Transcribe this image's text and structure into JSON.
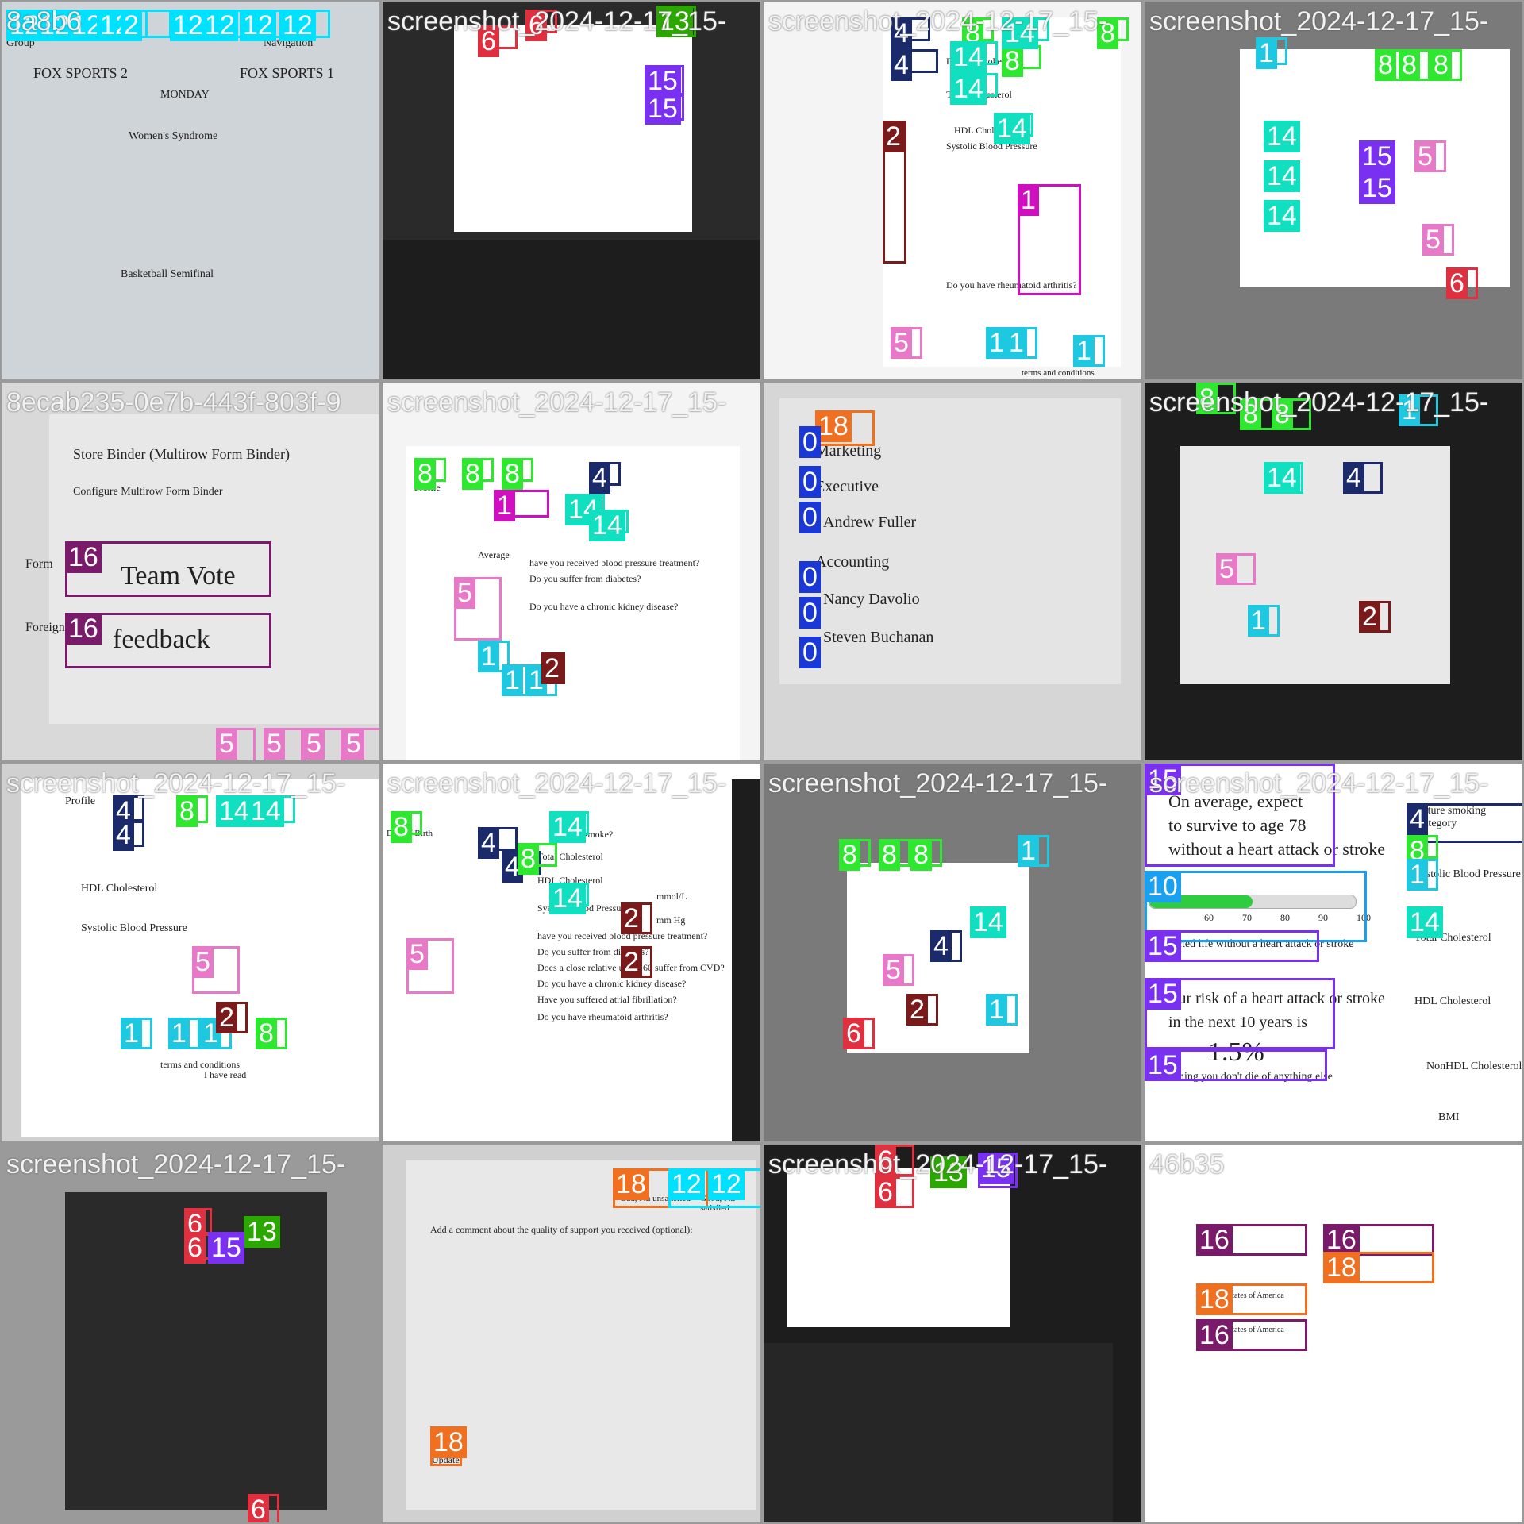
{
  "mosaic": {
    "grid": {
      "rows": 4,
      "cols": 4
    },
    "colors": {
      "c0": "#1a38d8",
      "c1": "#1ec8e0",
      "c2": "#7a1a1a",
      "c4": "#1a2a6a",
      "c5": "#e878c8",
      "c6": "#e03040",
      "c8": "#2ee830",
      "c10": "#1aa0f0",
      "c11": "#d010c0",
      "c12": "#00e0ff",
      "c13": "#2aa800",
      "c14": "#10e0c0",
      "c15": "#7a30f0",
      "c16": "#7a1a6a",
      "c18": "#f07020"
    },
    "tiles": [
      {
        "title": "8a8b6",
        "bg": "#cfd4d8",
        "boxes": [
          {
            "label": "12",
            "color": "c12"
          },
          {
            "label": "12",
            "color": "c12"
          },
          {
            "label": "12",
            "color": "c12"
          },
          {
            "label": "12",
            "color": "c12"
          },
          {
            "label": "2",
            "color": "c12"
          },
          {
            "label": "12",
            "color": "c12"
          },
          {
            "label": "12",
            "color": "c12"
          },
          {
            "label": "12",
            "color": "c12"
          },
          {
            "label": "12",
            "color": "c12"
          }
        ],
        "texts": [
          "FOX SPORTS 2",
          "FOX SPORTS 1",
          "MONDAY",
          "Women's Syndrome",
          "Basketball Semifinal",
          "Navigation",
          "Group"
        ]
      },
      {
        "title": "screenshot_2024-12-17_15-",
        "bg": "#2a2a2a",
        "boxes": [
          {
            "label": "6",
            "color": "c6"
          },
          {
            "label": "6",
            "color": "c6"
          },
          {
            "label": "13",
            "color": "c13"
          },
          {
            "label": "15",
            "color": "c15"
          },
          {
            "label": "15",
            "color": "c15"
          }
        ],
        "texts": []
      },
      {
        "title": "screenshot_2024-12-17_15-",
        "bg": "#f4f4f4",
        "boxes": [
          {
            "label": "4",
            "color": "c4"
          },
          {
            "label": "8",
            "color": "c8"
          },
          {
            "label": "14",
            "color": "c14"
          },
          {
            "label": "4",
            "color": "c4"
          },
          {
            "label": "14",
            "color": "c14"
          },
          {
            "label": "8",
            "color": "c8"
          },
          {
            "label": "14",
            "color": "c14"
          },
          {
            "label": "1",
            "color": "c11"
          },
          {
            "label": "5",
            "color": "c5"
          },
          {
            "label": "1",
            "color": "c1"
          },
          {
            "label": "1",
            "color": "c1"
          },
          {
            "label": "1",
            "color": "c1"
          },
          {
            "label": "8",
            "color": "c8"
          },
          {
            "label": "2",
            "color": "c2"
          },
          {
            "label": "14",
            "color": "c14"
          }
        ],
        "texts": [
          "Do you smoke?",
          "Total Cholesterol",
          "HDL Cholesterol",
          "Systolic Blood Pressure",
          "Do you have rheumatoid arthritis?",
          "terms and conditions"
        ]
      },
      {
        "title": "screenshot_2024-12-17_15-",
        "bg": "#7a7a7a",
        "boxes": [
          {
            "label": "1",
            "color": "c1"
          },
          {
            "label": "8",
            "color": "c8"
          },
          {
            "label": "8",
            "color": "c8"
          },
          {
            "label": "8",
            "color": "c8"
          },
          {
            "label": "5",
            "color": "c5"
          },
          {
            "label": "14",
            "color": "c14"
          },
          {
            "label": "14",
            "color": "c14"
          },
          {
            "label": "14",
            "color": "c14"
          },
          {
            "label": "15",
            "color": "c15"
          },
          {
            "label": "15",
            "color": "c15"
          },
          {
            "label": "5",
            "color": "c5"
          },
          {
            "label": "6",
            "color": "c6"
          }
        ],
        "texts": []
      },
      {
        "title": "8ecab235-0e7b-443f-803f-9",
        "bg": "#d9d9d9",
        "boxes": [
          {
            "label": "16",
            "color": "c16"
          },
          {
            "label": "16",
            "color": "c16"
          },
          {
            "label": "5",
            "color": "c5"
          },
          {
            "label": "5",
            "color": "c5"
          },
          {
            "label": "5",
            "color": "c5"
          },
          {
            "label": "5",
            "color": "c5"
          }
        ],
        "texts": [
          "Store Binder (Multirow Form Binder)",
          "Configure Multirow Form Binder",
          "Form",
          "Foreign Key",
          "Team Vote",
          "feedback"
        ]
      },
      {
        "title": "screenshot_2024-12-17_15-",
        "bg": "#f4f4f4",
        "boxes": [
          {
            "label": "8",
            "color": "c8"
          },
          {
            "label": "8",
            "color": "c8"
          },
          {
            "label": "8",
            "color": "c8"
          },
          {
            "label": "1",
            "color": "c11"
          },
          {
            "label": "4",
            "color": "c4"
          },
          {
            "label": "14",
            "color": "c14"
          },
          {
            "label": "14",
            "color": "c14"
          },
          {
            "label": "5",
            "color": "c5"
          },
          {
            "label": "1",
            "color": "c1"
          },
          {
            "label": "1",
            "color": "c1"
          },
          {
            "label": "1",
            "color": "c1"
          },
          {
            "label": "2",
            "color": "c2"
          }
        ],
        "texts": [
          "Profile",
          "Average",
          "have you received blood pressure treatment?",
          "Do you suffer from diabetes?",
          "Do you have a chronic kidney disease?"
        ]
      },
      {
        "title": "",
        "bg": "#d6d6d6",
        "boxes": [
          {
            "label": "18",
            "color": "c18"
          },
          {
            "label": "0",
            "color": "c0"
          },
          {
            "label": "0",
            "color": "c0"
          },
          {
            "label": "0",
            "color": "c0"
          },
          {
            "label": "0",
            "color": "c0"
          },
          {
            "label": "0",
            "color": "c0"
          },
          {
            "label": "0",
            "color": "c0"
          }
        ],
        "texts": [
          "Marketing",
          "Executive",
          "Andrew Fuller",
          "Accounting",
          "Nancy Davolio",
          "Steven Buchanan"
        ]
      },
      {
        "title": "screenshot_2024-12-17_15-",
        "bg": "#2a2a2a",
        "boxes": [
          {
            "label": "8",
            "color": "c8"
          },
          {
            "label": "8",
            "color": "c8"
          },
          {
            "label": "8",
            "color": "c8"
          },
          {
            "label": "1",
            "color": "c1"
          },
          {
            "label": "4",
            "color": "c4"
          },
          {
            "label": "14",
            "color": "c14"
          },
          {
            "label": "5",
            "color": "c5"
          },
          {
            "label": "2",
            "color": "c2"
          },
          {
            "label": "1",
            "color": "c1"
          }
        ],
        "texts": []
      },
      {
        "title": "screenshot_2024-12-17_15-",
        "bg": "#d0d0d0",
        "boxes": [
          {
            "label": "4",
            "color": "c4"
          },
          {
            "label": "4",
            "color": "c4"
          },
          {
            "label": "8",
            "color": "c8"
          },
          {
            "label": "14",
            "color": "c14"
          },
          {
            "label": "14",
            "color": "c14"
          },
          {
            "label": "5",
            "color": "c5"
          },
          {
            "label": "1",
            "color": "c1"
          },
          {
            "label": "1",
            "color": "c1"
          },
          {
            "label": "1",
            "color": "c1"
          },
          {
            "label": "2",
            "color": "c2"
          },
          {
            "label": "8",
            "color": "c8"
          }
        ],
        "texts": [
          "Profile",
          "HDL Cholesterol",
          "Systolic Blood Pressure",
          "terms and conditions",
          "I have read"
        ]
      },
      {
        "title": "screenshot_2024-12-17_15-",
        "bg": "#ffffff",
        "boxes": [
          {
            "label": "8",
            "color": "c8"
          },
          {
            "label": "4",
            "color": "c4"
          },
          {
            "label": "14",
            "color": "c14"
          },
          {
            "label": "4",
            "color": "c4"
          },
          {
            "label": "8",
            "color": "c8"
          },
          {
            "label": "14",
            "color": "c14"
          },
          {
            "label": "5",
            "color": "c5"
          },
          {
            "label": "2",
            "color": "c2"
          },
          {
            "label": "2",
            "color": "c2"
          }
        ],
        "texts": [
          "Do you smoke?",
          "Total Cholesterol",
          "HDL Cholesterol",
          "Systolic Blood Pressure",
          "Date of Birth",
          "have you received blood pressure treatment?",
          "Do you suffer from diabetes?",
          "Does a close relative under 60 suffer from CVD?",
          "Do you have a chronic kidney disease?",
          "Have you suffered atrial fibrillation?",
          "Do you have rheumatoid arthritis?",
          "mmol/L",
          "mm Hg"
        ]
      },
      {
        "title": "screenshot_2024-12-17_15-",
        "bg": "#7a7a7a",
        "boxes": [
          {
            "label": "8",
            "color": "c8"
          },
          {
            "label": "8",
            "color": "c8"
          },
          {
            "label": "8",
            "color": "c8"
          },
          {
            "label": "1",
            "color": "c1"
          },
          {
            "label": "14",
            "color": "c14"
          },
          {
            "label": "4",
            "color": "c4"
          },
          {
            "label": "5",
            "color": "c5"
          },
          {
            "label": "2",
            "color": "c2"
          },
          {
            "label": "1",
            "color": "c1"
          },
          {
            "label": "6",
            "color": "c6"
          }
        ],
        "texts": []
      },
      {
        "title": "screenshot_2024-12-17_15-",
        "bg": "#ffffff",
        "boxes": [
          {
            "label": "15",
            "color": "c15"
          },
          {
            "label": "10",
            "color": "c10"
          },
          {
            "label": "15",
            "color": "c15"
          },
          {
            "label": "15",
            "color": "c15"
          },
          {
            "label": "15",
            "color": "c15"
          },
          {
            "label": "4",
            "color": "c4"
          },
          {
            "label": "8",
            "color": "c8"
          },
          {
            "label": "1",
            "color": "c1"
          },
          {
            "label": "14",
            "color": "c14"
          }
        ],
        "texts": [
          "On average, expect",
          "to survive to age 78",
          "without a heart attack or stroke",
          "Expected life without a heart attack or stroke",
          "Your risk of a heart attack or stroke",
          "in the next 10 years is",
          "1.5%",
          "assuming you don't die of anything else",
          "Systolic Blood Pressure",
          "Total Cholesterol",
          "HDL Cholesterol",
          "NonHDL Cholesterol",
          "BMI",
          "future smoking category"
        ],
        "progress": 0.5,
        "ticks": [
          "60",
          "70",
          "80",
          "90",
          "100"
        ]
      },
      {
        "title": "screenshot_2024-12-17_15-",
        "bg": "#9a9a9a",
        "boxes": [
          {
            "label": "6",
            "color": "c6"
          },
          {
            "label": "6",
            "color": "c6"
          },
          {
            "label": "13",
            "color": "c13"
          },
          {
            "label": "15",
            "color": "c15"
          },
          {
            "label": "6",
            "color": "c6"
          }
        ],
        "texts": []
      },
      {
        "title": "",
        "bg": "#d0d0d0",
        "boxes": [
          {
            "label": "18",
            "color": "c18"
          },
          {
            "label": "12",
            "color": "c12"
          },
          {
            "label": "12",
            "color": "c12"
          },
          {
            "label": "18",
            "color": "c18"
          }
        ],
        "texts": [
          "Bad, I'm unsatisfied",
          "Good, I'm satisfied",
          "Add a comment about the quality of support you received (optional):",
          "Update"
        ]
      },
      {
        "title": "screenshot_2024-12-17_15-",
        "bg": "#2a2a2a",
        "boxes": [
          {
            "label": "6",
            "color": "c6"
          },
          {
            "label": "6",
            "color": "c6"
          },
          {
            "label": "13",
            "color": "c13"
          },
          {
            "label": "15",
            "color": "c15"
          }
        ],
        "texts": []
      },
      {
        "title": "46b35",
        "bg": "#ffffff",
        "boxes": [
          {
            "label": "16",
            "color": "c16"
          },
          {
            "label": "16",
            "color": "c16"
          },
          {
            "label": "18",
            "color": "c18"
          },
          {
            "label": "18",
            "color": "c18"
          },
          {
            "label": "16",
            "color": "c16"
          }
        ],
        "texts": [
          "United States of America",
          "United States of America"
        ]
      }
    ]
  }
}
